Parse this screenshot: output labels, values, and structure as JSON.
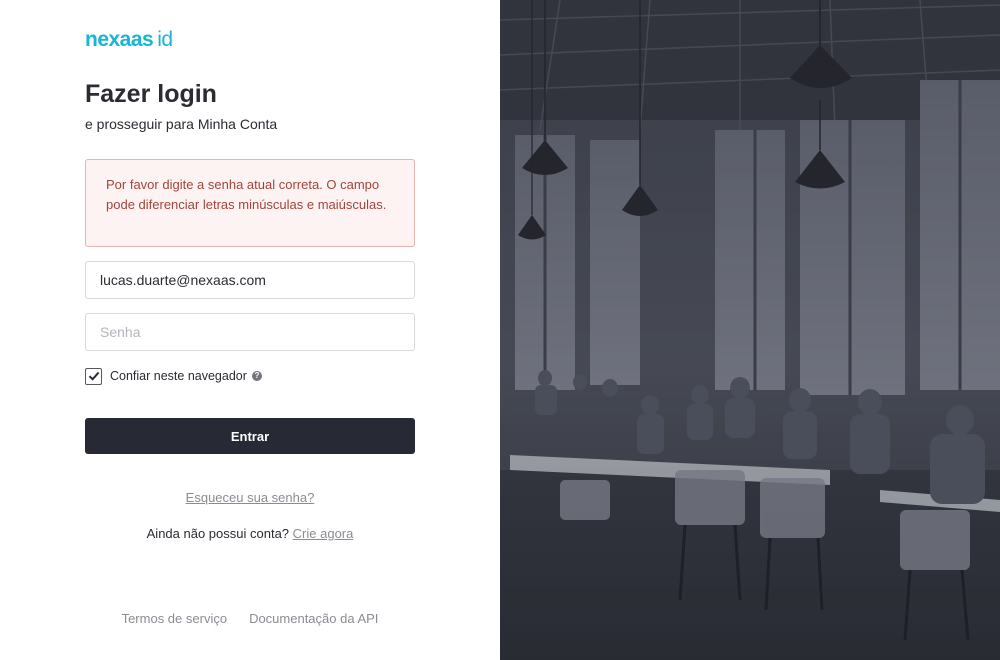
{
  "logo": {
    "brand": "nexaas",
    "suffix": "id"
  },
  "header": {
    "title": "Fazer login",
    "subtitle": "e prosseguir para Minha Conta"
  },
  "alert": {
    "message": "Por favor digite a senha atual correta. O campo pode diferenciar letras minúsculas e maiúsculas."
  },
  "form": {
    "email_value": "lucas.duarte@nexaas.com",
    "password_placeholder": "Senha",
    "trust_label": "Confiar neste navegador",
    "trust_checked": true,
    "help_icon_glyph": "?",
    "submit_label": "Entrar"
  },
  "links": {
    "forgot": "Esqueceu sua senha?",
    "signup_prompt": "Ainda não possui conta?",
    "signup_link": "Crie agora"
  },
  "footer": {
    "terms": "Termos de serviço",
    "api_docs": "Documentação da API"
  },
  "colors": {
    "brand": "#17b5d6",
    "button": "#272935",
    "alert_bg": "#fdf3f2",
    "alert_text": "#a3443c",
    "photo_tint": "#3b3e49"
  }
}
